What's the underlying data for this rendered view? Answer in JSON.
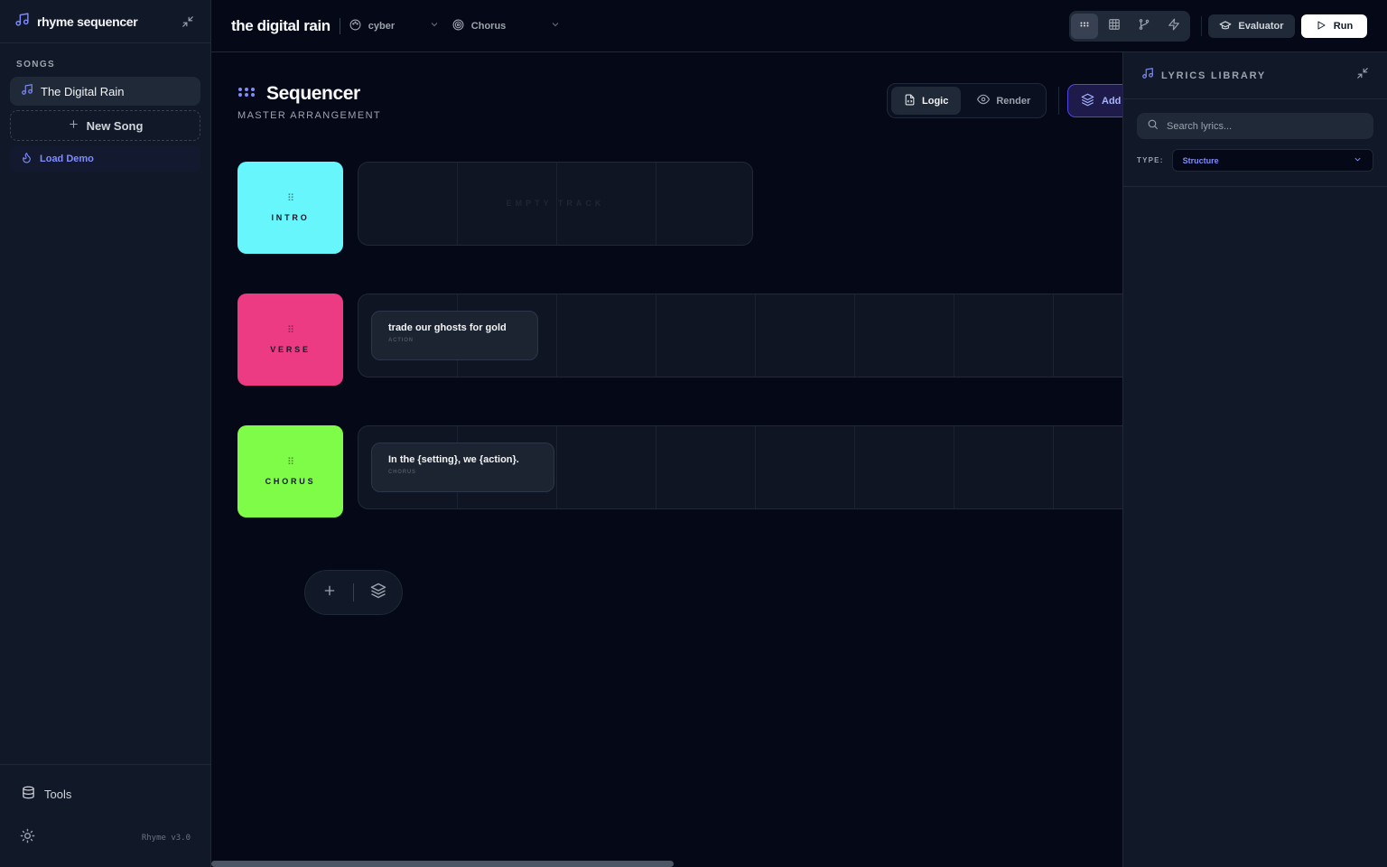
{
  "sidebar": {
    "app_name": "rhyme sequencer",
    "songs_label": "SONGS",
    "songs": [
      {
        "label": "The Digital Rain"
      }
    ],
    "new_song_label": "New Song",
    "load_demo_label": "Load Demo",
    "tools_label": "Tools",
    "version": "Rhyme v3.0"
  },
  "topbar": {
    "project_title": "the digital rain",
    "theme_select": "cyber",
    "section_select": "Chorus",
    "evaluator_label": "Evaluator",
    "run_label": "Run"
  },
  "sequencer": {
    "title": "Sequencer",
    "subtitle": "MASTER ARRANGEMENT",
    "mode_logic": "Logic",
    "mode_render": "Render",
    "add_label": "Add",
    "empty_track_text": "EMPTY TRACK",
    "tracks": [
      {
        "label": "INTRO",
        "color": "#67f6fb"
      },
      {
        "label": "VERSE",
        "color": "#ec3b83",
        "block": {
          "text": "trade our ghosts for gold",
          "type": "ACTION"
        }
      },
      {
        "label": "CHORUS",
        "color": "#7efc47",
        "block": {
          "text": "In the {setting}, we {action}.",
          "type": "CHORUS"
        }
      }
    ]
  },
  "library": {
    "title": "LYRICS LIBRARY",
    "search_placeholder": "Search lyrics...",
    "type_label": "TYPE:",
    "type_value": "Structure"
  },
  "colors": {
    "accent": "#6366f1",
    "background": "#050816",
    "panel": "#111827"
  }
}
